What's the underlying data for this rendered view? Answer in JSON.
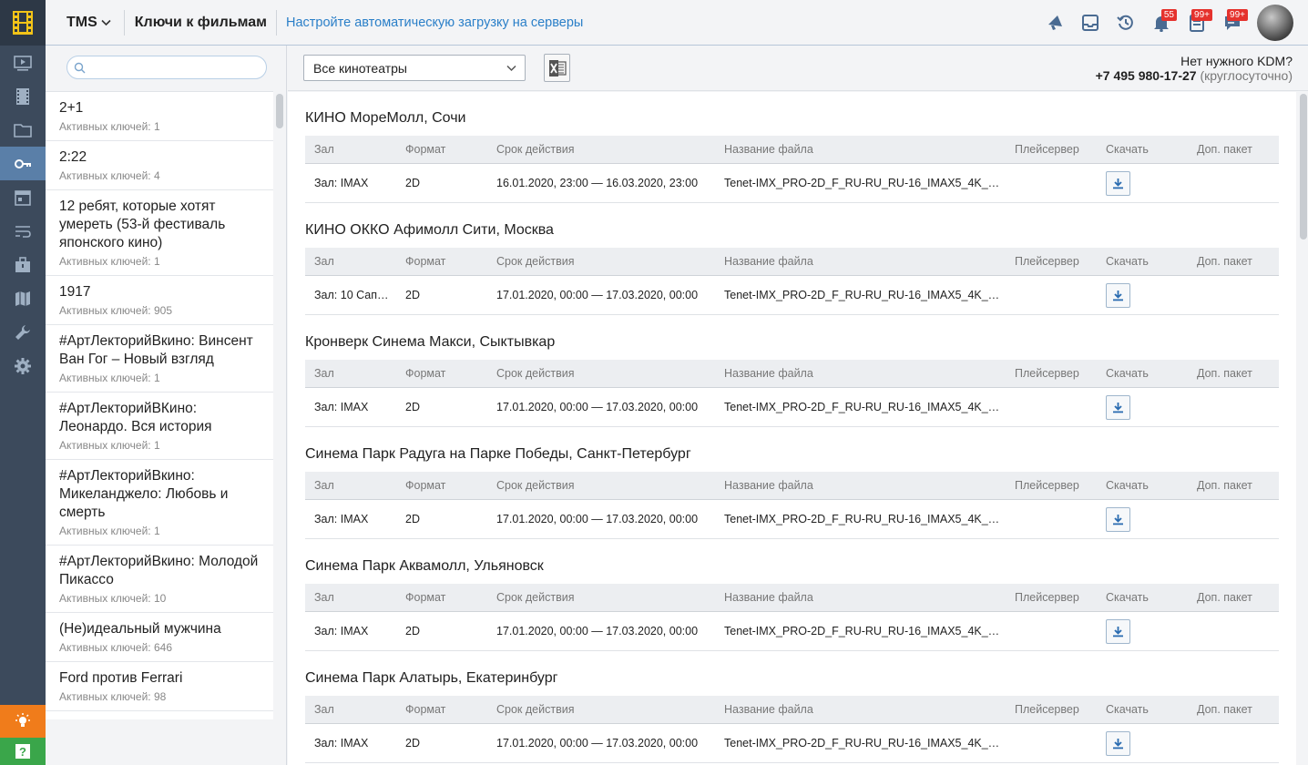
{
  "header": {
    "brand": "TMS",
    "page_title": "Ключи к фильмам",
    "link": "Настройте автоматическую загрузку на серверы",
    "badges": {
      "notifications": "55",
      "tasks": "99+",
      "messages": "99+"
    }
  },
  "search": {
    "placeholder": "",
    "value": ""
  },
  "films": [
    {
      "title": "2+1",
      "keys": "Активных ключей: 1"
    },
    {
      "title": "2:22",
      "keys": "Активных ключей: 4"
    },
    {
      "title": "12 ребят, которые хотят умереть (53-й фестиваль японского кино)",
      "keys": "Активных ключей: 1"
    },
    {
      "title": "1917",
      "keys": "Активных ключей: 905"
    },
    {
      "title": "#АртЛекторийВкино: Винсент Ван Гог – Новый взгляд",
      "keys": "Активных ключей: 1"
    },
    {
      "title": "#АртЛекторийВКино: Леонардо. Вся история",
      "keys": "Активных ключей: 1"
    },
    {
      "title": "#АртЛекторийВкино: Микеланджело: Любовь и смерть",
      "keys": "Активных ключей: 1"
    },
    {
      "title": "#АртЛекторийВкино: Молодой Пикассо",
      "keys": "Активных ключей: 10"
    },
    {
      "title": "(Не)идеальный мужчина",
      "keys": "Активных ключей: 646"
    },
    {
      "title": "Ford против Ferrari",
      "keys": "Активных ключей: 98"
    }
  ],
  "toolbar": {
    "cinema_select": "Все кинотеатры",
    "kdm_question": "Нет нужного KDM?",
    "kdm_phone": "+7 495 980-17-27",
    "kdm_hours": "(круглосуточно)"
  },
  "columns": {
    "hall": "Зал",
    "format": "Формат",
    "validity": "Срок действия",
    "filename": "Название файла",
    "player": "Плейсервер",
    "download": "Скачать",
    "extra": "Доп. пакет"
  },
  "cinemas": [
    {
      "name": "КИНО МореМолл, Сочи",
      "hall": "Зал: IMAX",
      "format": "2D",
      "validity": "16.01.2020, 23:00 — 16.03.2020, 23:00",
      "file": "Tenet-IMX_PRO-2D_F_RU-RU_RU-16_IMAX5_4K_…",
      "player": "",
      "extra": ""
    },
    {
      "name": "КИНО ОККО Афимолл Сити, Москва",
      "hall": "Зал: 10 Сап…",
      "format": "2D",
      "validity": "17.01.2020, 00:00 — 17.03.2020, 00:00",
      "file": "Tenet-IMX_PRO-2D_F_RU-RU_RU-16_IMAX5_4K_…",
      "player": "",
      "extra": ""
    },
    {
      "name": "Кронверк Синема Макси, Сыктывкар",
      "hall": "Зал: IMAX",
      "format": "2D",
      "validity": "17.01.2020, 00:00 — 17.03.2020, 00:00",
      "file": "Tenet-IMX_PRO-2D_F_RU-RU_RU-16_IMAX5_4K_…",
      "player": "",
      "extra": ""
    },
    {
      "name": "Синема Парк Радуга на Парке Победы, Санкт-Петербург",
      "hall": "Зал: IMAX",
      "format": "2D",
      "validity": "17.01.2020, 00:00 — 17.03.2020, 00:00",
      "file": "Tenet-IMX_PRO-2D_F_RU-RU_RU-16_IMAX5_4K_…",
      "player": "",
      "extra": ""
    },
    {
      "name": "Синема Парк Аквамолл, Ульяновск",
      "hall": "Зал: IMAX",
      "format": "2D",
      "validity": "17.01.2020, 00:00 — 17.03.2020, 00:00",
      "file": "Tenet-IMX_PRO-2D_F_RU-RU_RU-16_IMAX5_4K_…",
      "player": "",
      "extra": ""
    },
    {
      "name": "Синема Парк Алатырь, Екатеринбург",
      "hall": "Зал: IMAX",
      "format": "2D",
      "validity": "17.01.2020, 00:00 — 17.03.2020, 00:00",
      "file": "Tenet-IMX_PRO-2D_F_RU-RU_RU-16_IMAX5_4K_…",
      "player": "",
      "extra": ""
    }
  ]
}
